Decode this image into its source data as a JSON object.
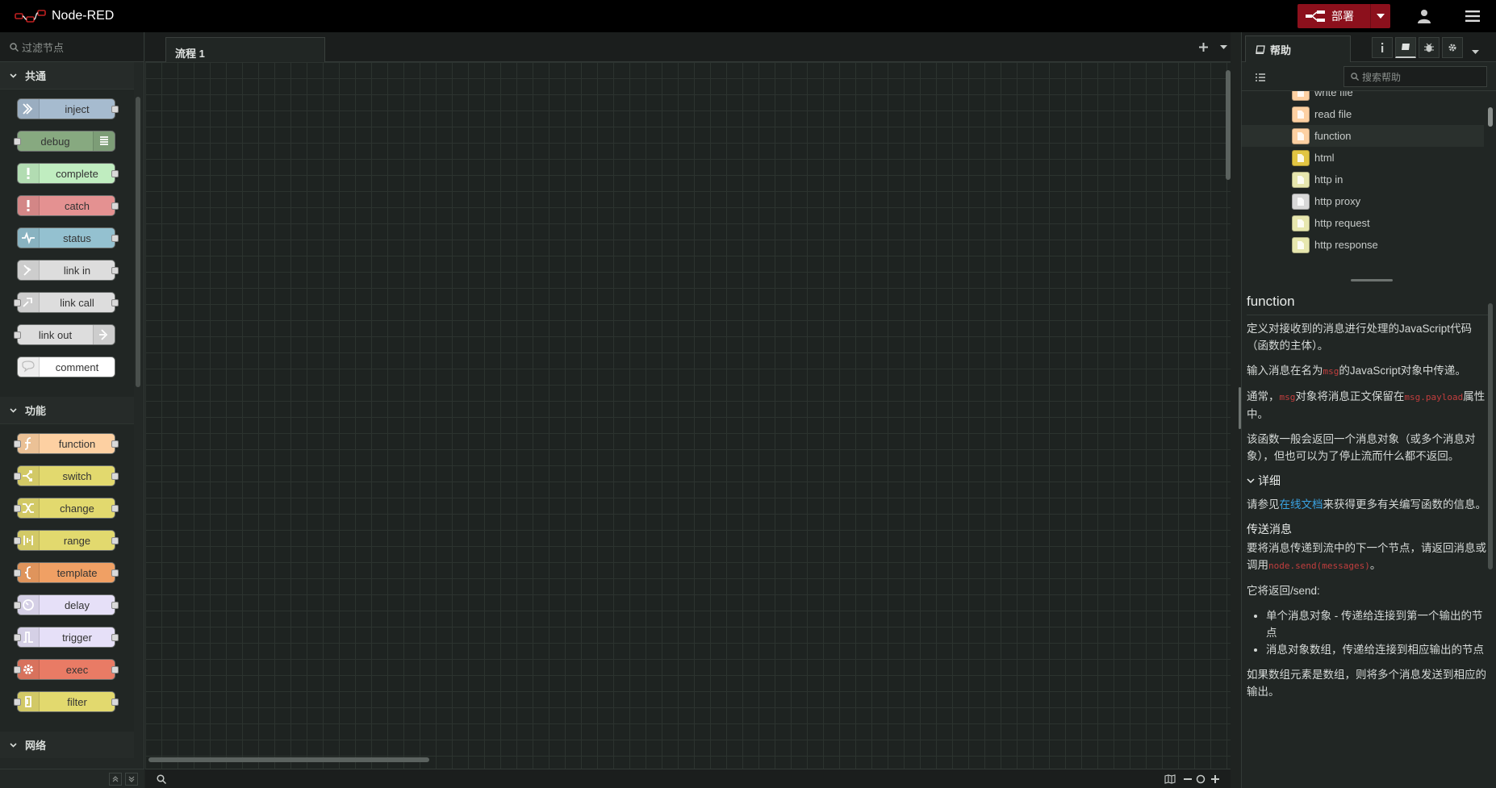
{
  "app": {
    "title": "Node-RED",
    "deploy_label": "部署"
  },
  "palette": {
    "filter_placeholder": "过滤节点",
    "categories": [
      {
        "name": "共通",
        "nodes": [
          {
            "label": "inject",
            "color": "#a6bbcf",
            "icon": "arrow-in-icon",
            "inputs": false,
            "outputs": true
          },
          {
            "label": "debug",
            "color": "#87a980",
            "icon": "list-icon",
            "inputs": true,
            "outputs": false,
            "icon_right": true
          },
          {
            "label": "complete",
            "color": "#c0edc0",
            "icon": "exclamation-icon",
            "inputs": false,
            "outputs": true
          },
          {
            "label": "catch",
            "color": "#e49191",
            "icon": "exclamation-icon",
            "inputs": false,
            "outputs": true
          },
          {
            "label": "status",
            "color": "#94c1d0",
            "icon": "pulse-icon",
            "inputs": false,
            "outputs": true
          },
          {
            "label": "link in",
            "color": "#dddddd",
            "icon": "link-in-icon",
            "inputs": false,
            "outputs": true
          },
          {
            "label": "link call",
            "color": "#dddddd",
            "icon": "link-call-icon",
            "inputs": true,
            "outputs": true
          },
          {
            "label": "link out",
            "color": "#dddddd",
            "icon": "link-out-icon",
            "inputs": true,
            "outputs": false,
            "icon_right": true
          },
          {
            "label": "comment",
            "color": "#ffffff",
            "icon": "comment-icon",
            "inputs": false,
            "outputs": false
          }
        ]
      },
      {
        "name": "功能",
        "nodes": [
          {
            "label": "function",
            "color": "#fdd0a2",
            "icon": "function-icon",
            "inputs": true,
            "outputs": true
          },
          {
            "label": "switch",
            "color": "#e2d96e",
            "icon": "switch-icon",
            "inputs": true,
            "outputs": true
          },
          {
            "label": "change",
            "color": "#e2d96e",
            "icon": "shuffle-icon",
            "inputs": true,
            "outputs": true
          },
          {
            "label": "range",
            "color": "#e2d96e",
            "icon": "range-icon",
            "inputs": true,
            "outputs": true
          },
          {
            "label": "template",
            "color": "#f0a064",
            "icon": "brace-icon",
            "inputs": true,
            "outputs": true
          },
          {
            "label": "delay",
            "color": "#e6e0f8",
            "icon": "timer-icon",
            "inputs": true,
            "outputs": true
          },
          {
            "label": "trigger",
            "color": "#e6e0f8",
            "icon": "trigger-icon",
            "inputs": true,
            "outputs": true
          },
          {
            "label": "exec",
            "color": "#e97b65",
            "icon": "gear-icon",
            "inputs": true,
            "outputs": true
          },
          {
            "label": "filter",
            "color": "#e2d96e",
            "icon": "filter-icon",
            "inputs": true,
            "outputs": true
          }
        ]
      },
      {
        "name": "网络",
        "nodes": []
      }
    ]
  },
  "workspace": {
    "tabs": [
      {
        "label": "流程 1"
      }
    ]
  },
  "sidebar": {
    "active_tab": "帮助",
    "search_placeholder": "搜索帮助",
    "tree": [
      {
        "label": "write file",
        "color": "#fdd0a2"
      },
      {
        "label": "read file",
        "color": "#fdd0a2"
      },
      {
        "label": "function",
        "color": "#fdd0a2",
        "selected": true
      },
      {
        "label": "html",
        "color": "#e2c542"
      },
      {
        "label": "http in",
        "color": "#e7e7ae"
      },
      {
        "label": "http proxy",
        "color": "#d8d8d8"
      },
      {
        "label": "http request",
        "color": "#e7e7ae"
      },
      {
        "label": "http response",
        "color": "#e7e7ae"
      }
    ],
    "help": {
      "title": "function",
      "p1": "定义对接收到的消息进行处理的JavaScript代码（函数的主体）。",
      "p2_before": "输入消息在名为",
      "p2_code": "msg",
      "p2_after": "的JavaScript对象中传递。",
      "p3_before": "通常，",
      "p3_code1": "msg",
      "p3_mid": "对象将消息正文保留在",
      "p3_code2": "msg.payload",
      "p3_after": "属性中。",
      "p4": "该函数一般会返回一个消息对象（或多个消息对象），但也可以为了停止流而什么都不返回。",
      "details_label": "详细",
      "p5_before": "请参见",
      "p5_link": "在线文档",
      "p5_after": "来获得更多有关编写函数的信息。",
      "h_send": "传送消息",
      "p6_before": "要将消息传递到流中的下一个节点，请返回消息或调用",
      "p6_code": "node.send(messages)",
      "p6_after": "。",
      "p7": "它将返回/send:",
      "li1": "单个消息对象 - 传递给连接到第一个输出的节点",
      "li2": "消息对象数组，传递给连接到相应输出的节点",
      "p8": "如果数组元素是数组，则将多个消息发送到相应的输出。"
    }
  }
}
